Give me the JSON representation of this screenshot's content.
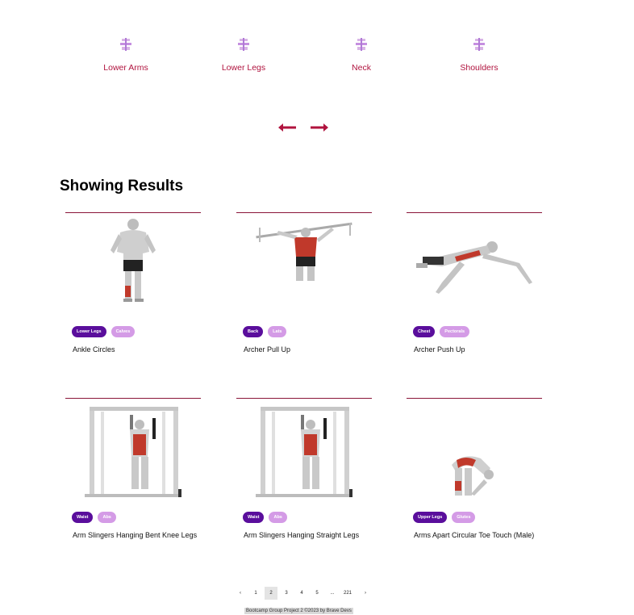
{
  "categories": [
    {
      "label": "Lower Arms",
      "icon": "gym-icon"
    },
    {
      "label": "Lower Legs",
      "icon": "gym-icon"
    },
    {
      "label": "Neck",
      "icon": "gym-icon"
    },
    {
      "label": "Shoulders",
      "icon": "gym-icon"
    }
  ],
  "nav": {
    "prev_icon": "left-arrow-icon",
    "next_icon": "right-arrow-icon"
  },
  "results": {
    "heading": "Showing Results",
    "cards": [
      {
        "name": "Ankle Circles",
        "body_part": "Lower Legs",
        "target": "Calves"
      },
      {
        "name": "Archer Pull Up",
        "body_part": "Back",
        "target": "Lats"
      },
      {
        "name": "Archer Push Up",
        "body_part": "Chest",
        "target": "Pectorals"
      },
      {
        "name": "Arm Slingers Hanging Bent Knee Legs",
        "body_part": "Waist",
        "target": "Abs"
      },
      {
        "name": "Arm Slingers Hanging Straight Legs",
        "body_part": "Waist",
        "target": "Abs"
      },
      {
        "name": "Arms Apart Circular Toe Touch (Male)",
        "body_part": "Upper Legs",
        "target": "Glutes"
      }
    ]
  },
  "pagination": {
    "prev": "‹",
    "pages": [
      "1",
      "2",
      "3",
      "4",
      "5",
      "...",
      "221"
    ],
    "active": "2",
    "next": "›"
  },
  "footer": {
    "text": "Bootcamp Group Project 2 ©2023 by Brave Devs"
  },
  "colors": {
    "accent": "#b0133e",
    "body_tag": "#5a0e9c",
    "target_tag": "#d49be6"
  }
}
